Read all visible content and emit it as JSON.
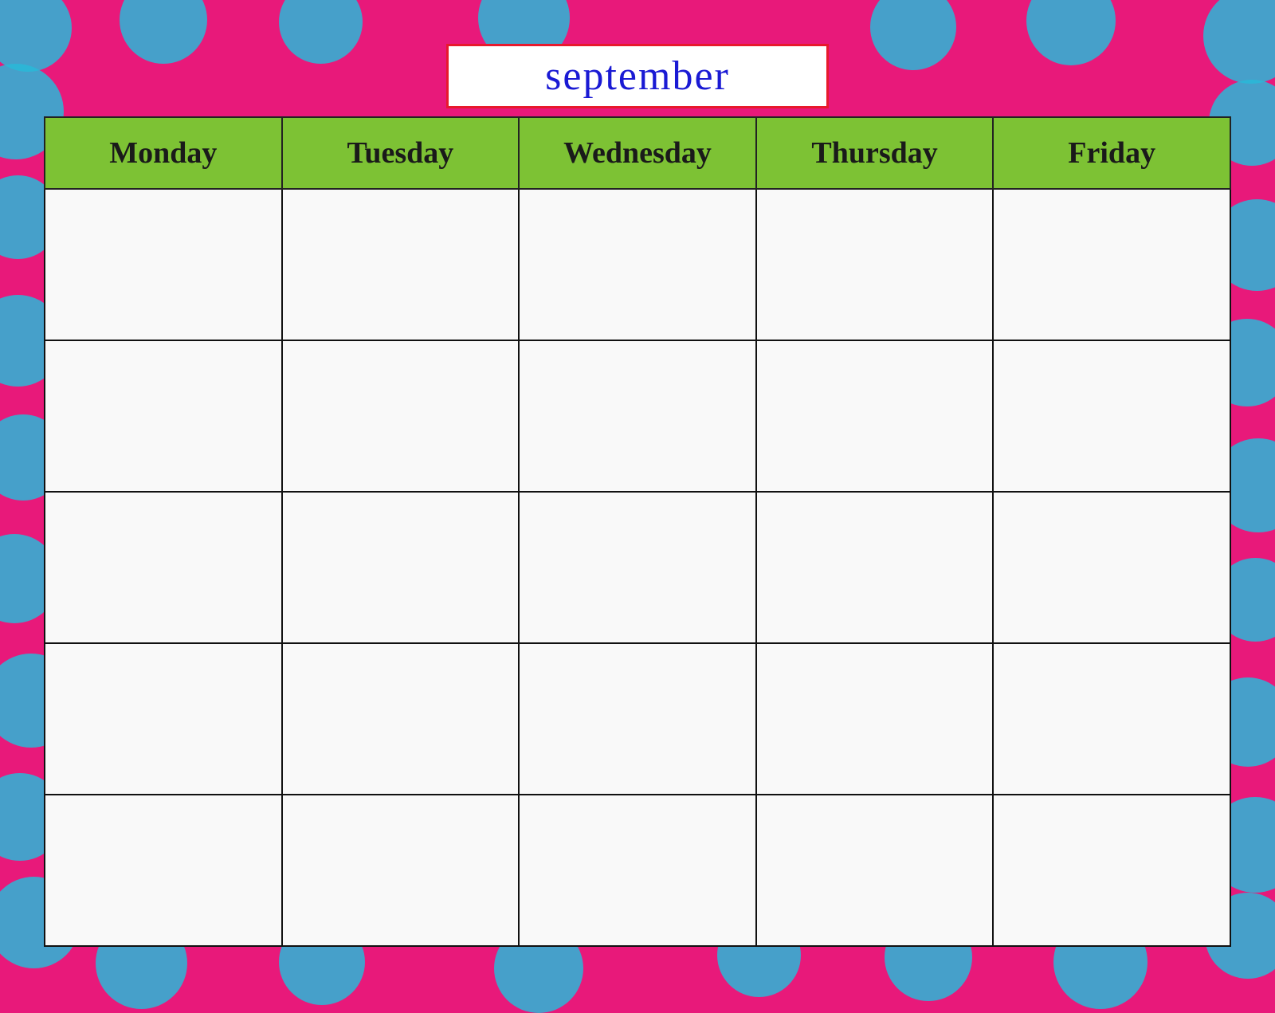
{
  "background": {
    "color": "#e8197a",
    "dot_color": "#29b8d8"
  },
  "title": {
    "text": "september",
    "border_color": "#e8192c",
    "text_color": "#1a1ad4"
  },
  "header": {
    "bg_color": "#7dc234",
    "days": [
      {
        "label": "Monday"
      },
      {
        "label": "Tuesday"
      },
      {
        "label": "Wednesday"
      },
      {
        "label": "Thursday"
      },
      {
        "label": "Friday"
      }
    ]
  },
  "calendar": {
    "rows": 5,
    "cols": 5
  }
}
